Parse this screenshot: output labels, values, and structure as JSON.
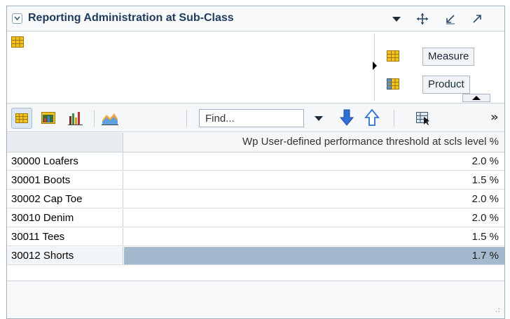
{
  "header": {
    "title": "Reporting Administration at Sub-Class",
    "icons": [
      "collapse-chevron-icon",
      "dropdown-caret-icon",
      "move-icon",
      "minimize-icon",
      "maximize-icon"
    ]
  },
  "layout": {
    "tiles": [
      {
        "label": "Measure",
        "icon": "measure-grid-icon"
      },
      {
        "label": "Product",
        "icon": "product-grid-icon"
      }
    ]
  },
  "toolbar": {
    "find_placeholder": "Find...",
    "more_label": "»",
    "icons": [
      "table-view-icon",
      "chart-table-icon",
      "bar-chart-icon",
      "area-chart-icon",
      "find-dropdown-icon",
      "arrow-down-icon",
      "arrow-up-icon",
      "export-grid-icon"
    ]
  },
  "table": {
    "column_header": "Wp User-defined performance threshold at scls level %",
    "rows": [
      {
        "label": "30000 Loafers",
        "value": "2.0 %"
      },
      {
        "label": "30001 Boots",
        "value": "1.5 %"
      },
      {
        "label": "30002 Cap Toe",
        "value": "2.0 %"
      },
      {
        "label": "30010 Denim",
        "value": "2.0 %"
      },
      {
        "label": "30011 Tees",
        "value": "1.5 %"
      },
      {
        "label": "30012 Shorts",
        "value": "1.7 %"
      }
    ]
  },
  "colors": {
    "title": "#1f3a5a",
    "selected_cell": "#a4b9ce",
    "arrow_blue": "#2f6fd6"
  }
}
